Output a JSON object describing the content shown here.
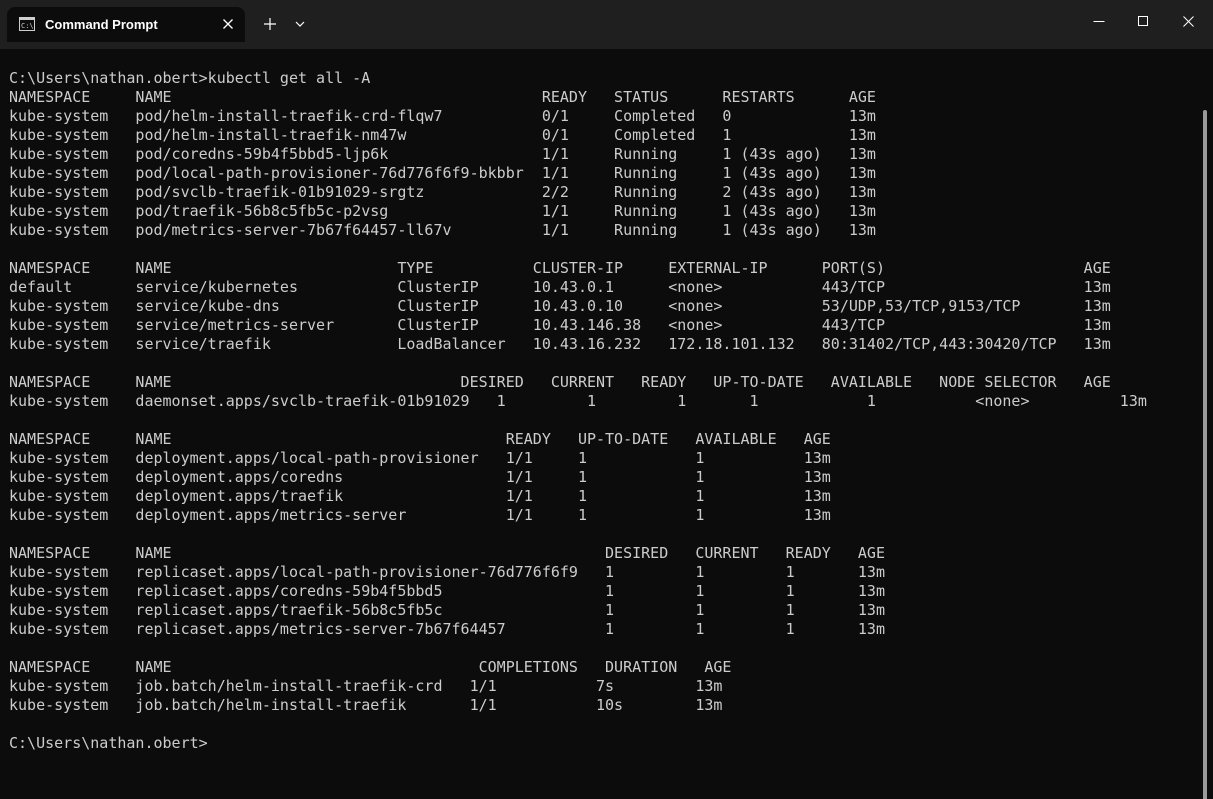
{
  "window": {
    "tab_title": "Command Prompt",
    "tab_icon": "cmd-icon",
    "new_tab_icon": "plus-icon",
    "dropdown_icon": "chevron-down-icon",
    "minimize_icon": "minimize-icon",
    "maximize_icon": "maximize-icon",
    "close_icon": "close-icon"
  },
  "colors": {
    "background": "#0c0c0c",
    "titlebar": "#1f1f1f",
    "text": "#cccccc"
  },
  "terminal": {
    "lines": [
      "C:\\Users\\nathan.obert>kubectl get all -A",
      "NAMESPACE     NAME                                         READY   STATUS      RESTARTS      AGE",
      "kube-system   pod/helm-install-traefik-crd-flqw7           0/1     Completed   0             13m",
      "kube-system   pod/helm-install-traefik-nm47w               0/1     Completed   1             13m",
      "kube-system   pod/coredns-59b4f5bbd5-ljp6k                 1/1     Running     1 (43s ago)   13m",
      "kube-system   pod/local-path-provisioner-76d776f6f9-bkbbr  1/1     Running     1 (43s ago)   13m",
      "kube-system   pod/svclb-traefik-01b91029-srgtz             2/2     Running     2 (43s ago)   13m",
      "kube-system   pod/traefik-56b8c5fb5c-p2vsg                 1/1     Running     1 (43s ago)   13m",
      "kube-system   pod/metrics-server-7b67f64457-ll67v          1/1     Running     1 (43s ago)   13m",
      "",
      "NAMESPACE     NAME                         TYPE           CLUSTER-IP     EXTERNAL-IP      PORT(S)                      AGE",
      "default       service/kubernetes           ClusterIP      10.43.0.1      <none>           443/TCP                      13m",
      "kube-system   service/kube-dns             ClusterIP      10.43.0.10     <none>           53/UDP,53/TCP,9153/TCP       13m",
      "kube-system   service/metrics-server       ClusterIP      10.43.146.38   <none>           443/TCP                      13m",
      "kube-system   service/traefik              LoadBalancer   10.43.16.232   172.18.101.132   80:31402/TCP,443:30420/TCP   13m",
      "",
      "NAMESPACE     NAME                                DESIRED   CURRENT   READY   UP-TO-DATE   AVAILABLE   NODE SELECTOR   AGE",
      "kube-system   daemonset.apps/svclb-traefik-01b91029   1         1         1       1            1           <none>          13m",
      "",
      "NAMESPACE     NAME                                     READY   UP-TO-DATE   AVAILABLE   AGE",
      "kube-system   deployment.apps/local-path-provisioner   1/1     1            1           13m",
      "kube-system   deployment.apps/coredns                  1/1     1            1           13m",
      "kube-system   deployment.apps/traefik                  1/1     1            1           13m",
      "kube-system   deployment.apps/metrics-server           1/1     1            1           13m",
      "",
      "NAMESPACE     NAME                                                DESIRED   CURRENT   READY   AGE",
      "kube-system   replicaset.apps/local-path-provisioner-76d776f6f9   1         1         1       13m",
      "kube-system   replicaset.apps/coredns-59b4f5bbd5                  1         1         1       13m",
      "kube-system   replicaset.apps/traefik-56b8c5fb5c                  1         1         1       13m",
      "kube-system   replicaset.apps/metrics-server-7b67f64457           1         1         1       13m",
      "",
      "NAMESPACE     NAME                                  COMPLETIONS   DURATION   AGE",
      "kube-system   job.batch/helm-install-traefik-crd   1/1           7s         13m",
      "kube-system   job.batch/helm-install-traefik       1/1           10s        13m",
      "",
      "C:\\Users\\nathan.obert>"
    ]
  }
}
